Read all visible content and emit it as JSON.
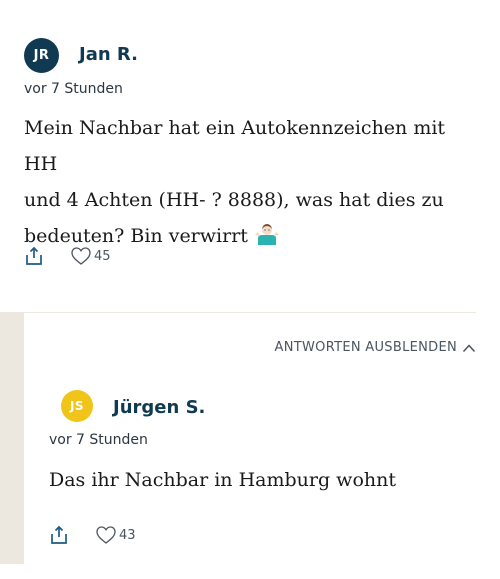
{
  "comment": {
    "avatar_initials": "JR",
    "author": "Jan R.",
    "timestamp": "vor 7 Stunden",
    "body_line1": "Mein Nachbar hat ein Autokennzeichen mit HH",
    "body_line2": "und 4 Achten (HH- ? 8888), was hat dies zu",
    "body_line3": "bedeuten? Bin verwirrt",
    "emoji": "man-shrugging-emoji",
    "likes": "45",
    "icons": {
      "share": "share-icon",
      "like": "heart-icon"
    }
  },
  "replies": {
    "toggle_label": "ANTWORTEN AUSBLENDEN",
    "toggle_icon": "chevron-up-icon",
    "items": [
      {
        "avatar_initials": "JS",
        "author": "Jürgen S.",
        "timestamp": "vor 7 Stunden",
        "body": "Das ihr Nachbar in Hamburg wohnt",
        "likes": "43"
      }
    ]
  },
  "colors": {
    "brand_dark": "#103a52",
    "avatar_yellow": "#f0c419",
    "reply_bar": "#ece8e0",
    "share_icon": "#1d5c86"
  }
}
